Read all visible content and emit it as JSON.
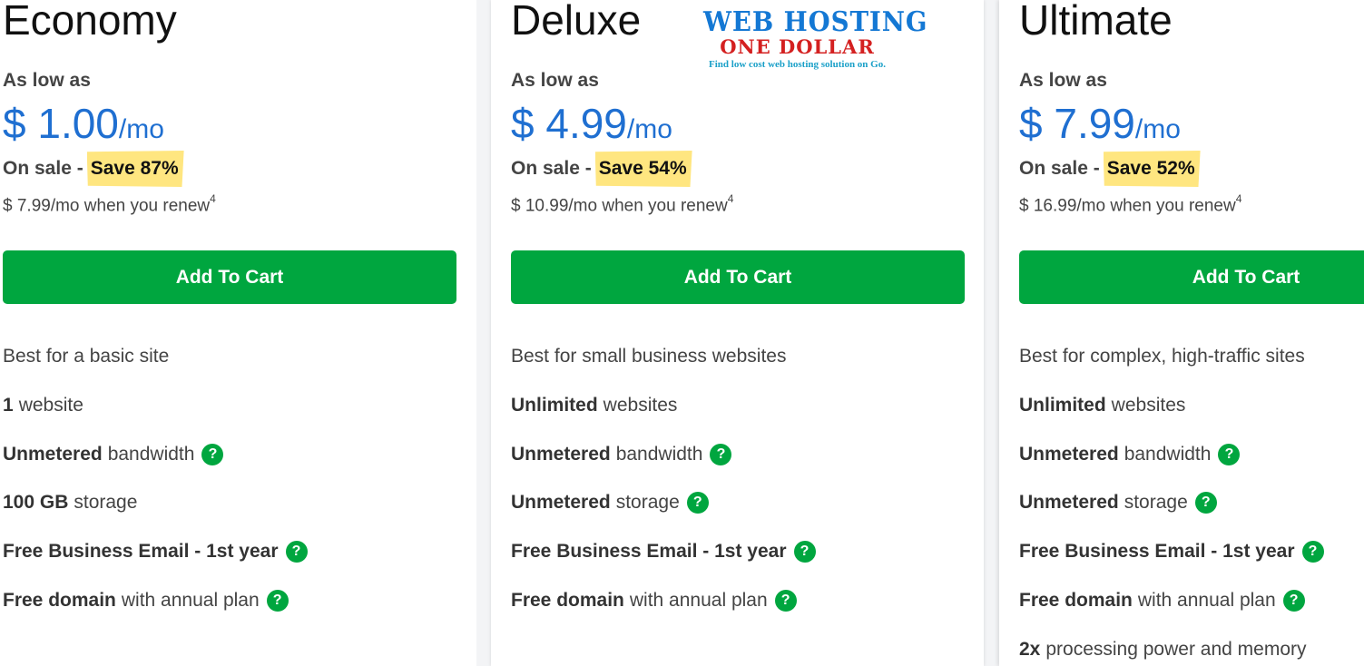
{
  "logo": {
    "line1": "WEB HOSTING",
    "line2": "ONE DOLLAR",
    "tagline": "Find low cost web hosting solution on Go."
  },
  "plans": [
    {
      "name": "Economy",
      "as_low_as": "As low as",
      "price": "$ 1.00",
      "per": "/mo",
      "on_sale": "On sale -",
      "save": "Save 87%",
      "renew": "$ 7.99/mo when you renew",
      "renew_note": "4",
      "cta": "Add To Cart",
      "features": [
        {
          "bold": "",
          "text": "Best for a basic site",
          "help": false
        },
        {
          "bold": "1",
          "text": "website",
          "help": false
        },
        {
          "bold": "Unmetered",
          "text": "bandwidth",
          "help": true
        },
        {
          "bold": "100 GB",
          "text": "storage",
          "help": false
        },
        {
          "bold": "Free Business Email - 1st year",
          "text": "",
          "help": true
        },
        {
          "bold": "Free domain",
          "text": "with annual plan",
          "help": true
        }
      ]
    },
    {
      "name": "Deluxe",
      "as_low_as": "As low as",
      "price": "$ 4.99",
      "per": "/mo",
      "on_sale": "On sale -",
      "save": "Save 54%",
      "renew": "$ 10.99/mo when you renew",
      "renew_note": "4",
      "cta": "Add To Cart",
      "features": [
        {
          "bold": "",
          "text": "Best for small business websites",
          "help": false
        },
        {
          "bold": "Unlimited",
          "text": "websites",
          "help": false
        },
        {
          "bold": "Unmetered",
          "text": "bandwidth",
          "help": true
        },
        {
          "bold": "Unmetered",
          "text": "storage",
          "help": true
        },
        {
          "bold": "Free Business Email - 1st year",
          "text": "",
          "help": true
        },
        {
          "bold": "Free domain",
          "text": "with annual plan",
          "help": true
        }
      ]
    },
    {
      "name": "Ultimate",
      "as_low_as": "As low as",
      "price": "$ 7.99",
      "per": "/mo",
      "on_sale": "On sale -",
      "save": "Save 52%",
      "renew": "$ 16.99/mo when you renew",
      "renew_note": "4",
      "cta": "Add To Cart",
      "features": [
        {
          "bold": "",
          "text": "Best for complex, high-traffic sites",
          "help": false
        },
        {
          "bold": "Unlimited",
          "text": "websites",
          "help": false
        },
        {
          "bold": "Unmetered",
          "text": "bandwidth",
          "help": true
        },
        {
          "bold": "Unmetered",
          "text": "storage",
          "help": true
        },
        {
          "bold": "Free Business Email - 1st year",
          "text": "",
          "help": true
        },
        {
          "bold": "Free domain",
          "text": "with annual plan",
          "help": true
        },
        {
          "bold": "2x",
          "text": "processing power and memory",
          "help": false
        }
      ]
    }
  ],
  "help_glyph": "?",
  "colors": {
    "price": "#1f6fd1",
    "cta": "#00a63f",
    "save_highlight": "#ffe680",
    "help_icon": "#00a63f"
  }
}
